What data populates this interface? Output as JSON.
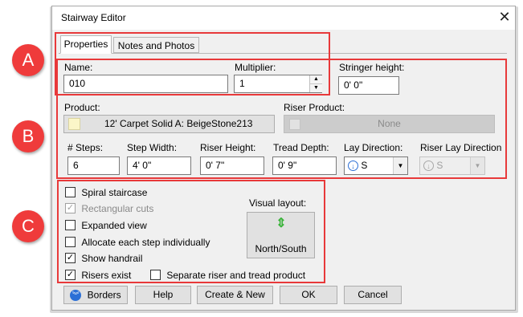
{
  "window": {
    "title": "Stairway Editor",
    "close_glyph": "✕"
  },
  "tabs": [
    {
      "label": "Properties",
      "active": true
    },
    {
      "label": "Notes and Photos",
      "active": false
    }
  ],
  "fields": {
    "name_label": "Name:",
    "name_value": "010",
    "multiplier_label": "Multiplier:",
    "multiplier_value": "1",
    "stringer_label": "Stringer height:",
    "stringer_value": "0' 0\"",
    "product_label": "Product:",
    "product_value": "12' Carpet Solid A: BeigeStone213",
    "product_swatch_color": "#fbf6c8",
    "riser_product_label": "Riser Product:",
    "riser_product_value": "None",
    "steps_label": "# Steps:",
    "steps_value": "6",
    "step_width_label": "Step Width:",
    "step_width_value": "4' 0\"",
    "riser_height_label": "Riser Height:",
    "riser_height_value": "0' 7\"",
    "tread_depth_label": "Tread Depth:",
    "tread_depth_value": "0' 9\"",
    "lay_direction_label": "Lay Direction:",
    "lay_direction_value": "S",
    "riser_lay_direction_label": "Riser Lay Direction",
    "riser_lay_direction_value": "S"
  },
  "checkboxes": [
    {
      "label": "Spiral staircase",
      "checked": false,
      "disabled": false
    },
    {
      "label": "Rectangular cuts",
      "checked": true,
      "disabled": true
    },
    {
      "label": "Expanded view",
      "checked": false,
      "disabled": false
    },
    {
      "label": "Allocate each step individually",
      "checked": false,
      "disabled": false
    },
    {
      "label": "Show handrail",
      "checked": true,
      "disabled": false
    },
    {
      "label": "Risers exist",
      "checked": true,
      "disabled": false
    },
    {
      "label": "Separate riser and tread product",
      "checked": false,
      "disabled": false
    }
  ],
  "visual_layout": {
    "label": "Visual layout:",
    "value": "North/South",
    "icon": "north-south-arrows-icon",
    "icon_color": "#3cb43c"
  },
  "buttons": {
    "borders": "Borders",
    "help": "Help",
    "create_new": "Create & New",
    "ok": "OK",
    "cancel": "Cancel"
  },
  "markers": [
    "A",
    "B",
    "C"
  ],
  "colors": {
    "highlight": "#e8393a",
    "marker": "#ef3b3b",
    "direction_icon": "#2b6fd6"
  }
}
